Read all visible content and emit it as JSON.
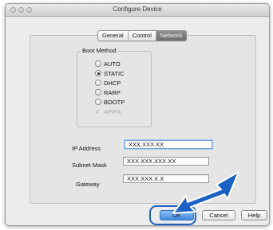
{
  "window": {
    "title": "Configure Device"
  },
  "tabs": [
    {
      "label": "General",
      "active": false
    },
    {
      "label": "Control",
      "active": false
    },
    {
      "label": "Network",
      "active": true
    }
  ],
  "boot_method": {
    "title": "Boot Method",
    "options": [
      {
        "label": "AUTO",
        "selected": false
      },
      {
        "label": "STATIC",
        "selected": true
      },
      {
        "label": "DHCP",
        "selected": false
      },
      {
        "label": "RARP",
        "selected": false
      },
      {
        "label": "BOOTP",
        "selected": false
      }
    ],
    "apipa": {
      "label": "APIPA",
      "checked": true,
      "enabled": false
    }
  },
  "fields": {
    "ip": {
      "label": "IP Address",
      "value": "XXX.XXX.XX"
    },
    "subnet": {
      "label": "Subnet Mask",
      "value": "XXX.XXX.XXX.XX"
    },
    "gateway": {
      "label": "Gateway",
      "value": "XXX.XXX.X.X"
    }
  },
  "buttons": {
    "ok": "OK",
    "cancel": "Cancel",
    "help": "Help"
  },
  "colors": {
    "accent": "#2f7fd6",
    "arrow": "#1b62c4"
  },
  "icons": {
    "apipa_check": "✓"
  }
}
